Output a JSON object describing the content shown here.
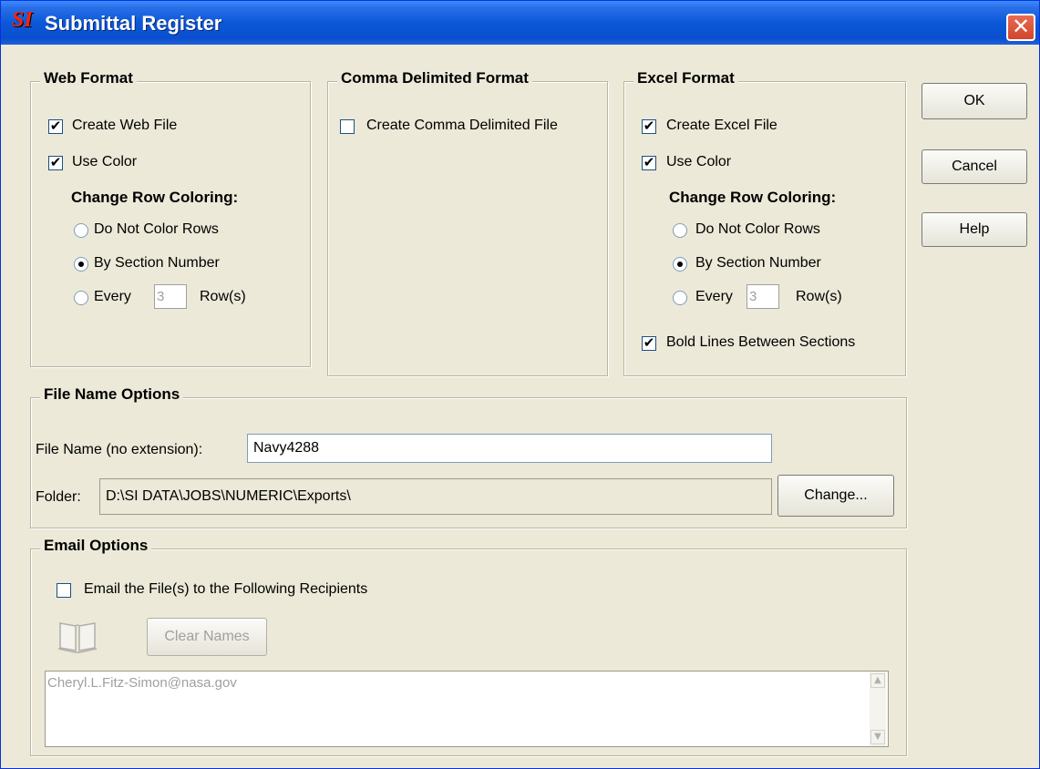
{
  "window": {
    "title": "Submittal Register",
    "logo_text": "SI"
  },
  "web_format": {
    "legend": "Web Format",
    "create_web_file": {
      "label": "Create Web File",
      "checked": true
    },
    "use_color": {
      "label": "Use Color",
      "checked": true
    },
    "row_coloring_heading": "Change Row Coloring:",
    "options": [
      "Do Not Color Rows",
      "By Section Number",
      "Every"
    ],
    "selected_option": "By Section Number",
    "every_value": "3",
    "rows_label": "Row(s)"
  },
  "comma_format": {
    "legend": "Comma Delimited Format",
    "create_file": {
      "label": "Create Comma Delimited File",
      "checked": false
    }
  },
  "excel_format": {
    "legend": "Excel Format",
    "create_excel_file": {
      "label": "Create Excel File",
      "checked": true
    },
    "use_color": {
      "label": "Use Color",
      "checked": true
    },
    "row_coloring_heading": "Change Row Coloring:",
    "options": [
      "Do Not Color Rows",
      "By Section Number",
      "Every"
    ],
    "selected_option": "By Section Number",
    "every_value": "3",
    "rows_label": "Row(s)",
    "bold_lines": {
      "label": "Bold Lines Between Sections",
      "checked": true
    }
  },
  "buttons": {
    "ok": "OK",
    "cancel": "Cancel",
    "help": "Help"
  },
  "file_name_options": {
    "legend": "File Name Options",
    "file_name_label": "File Name (no extension):",
    "file_name_value": "Navy4288",
    "folder_label": "Folder:",
    "folder_value": "D:\\SI DATA\\JOBS\\NUMERIC\\Exports\\",
    "change_button": "Change..."
  },
  "email_options": {
    "legend": "Email Options",
    "email_checkbox": {
      "label": "Email the File(s) to the Following Recipients",
      "checked": false
    },
    "address_book_icon": "book-icon",
    "clear_names_button": "Clear Names",
    "recipients": "Cheryl.L.Fitz-Simon@nasa.gov"
  },
  "colors": {
    "title_bar": "#0a58d8",
    "dialog_bg": "#ece9d8",
    "close_button": "#d0462b"
  }
}
